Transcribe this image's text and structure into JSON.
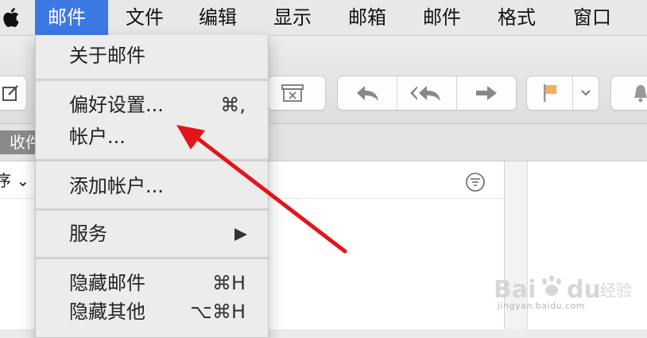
{
  "menubar": {
    "items": [
      "邮件",
      "文件",
      "编辑",
      "显示",
      "邮箱",
      "邮件",
      "格式",
      "窗口"
    ],
    "active_index": 0
  },
  "toolbar": {
    "inbox_tab_label": "收件",
    "flag_color": "#f6b05a"
  },
  "list_header": {
    "sort_label": "序 ⌄"
  },
  "mail_menu": {
    "about": "关于邮件",
    "preferences": "偏好设置...",
    "preferences_shortcut": "⌘,",
    "accounts": "帐户...",
    "add_account": "添加帐户...",
    "services": "服务",
    "hide_mail": "隐藏邮件",
    "hide_mail_shortcut": "⌘H",
    "hide_others": "隐藏其他",
    "hide_others_shortcut": "⌥⌘H"
  },
  "colors": {
    "accent": "#3c79e4",
    "annotation": "#e4141b"
  },
  "watermark": {
    "brand": "Baidu经验",
    "url": "jingyan.baidu.com"
  }
}
